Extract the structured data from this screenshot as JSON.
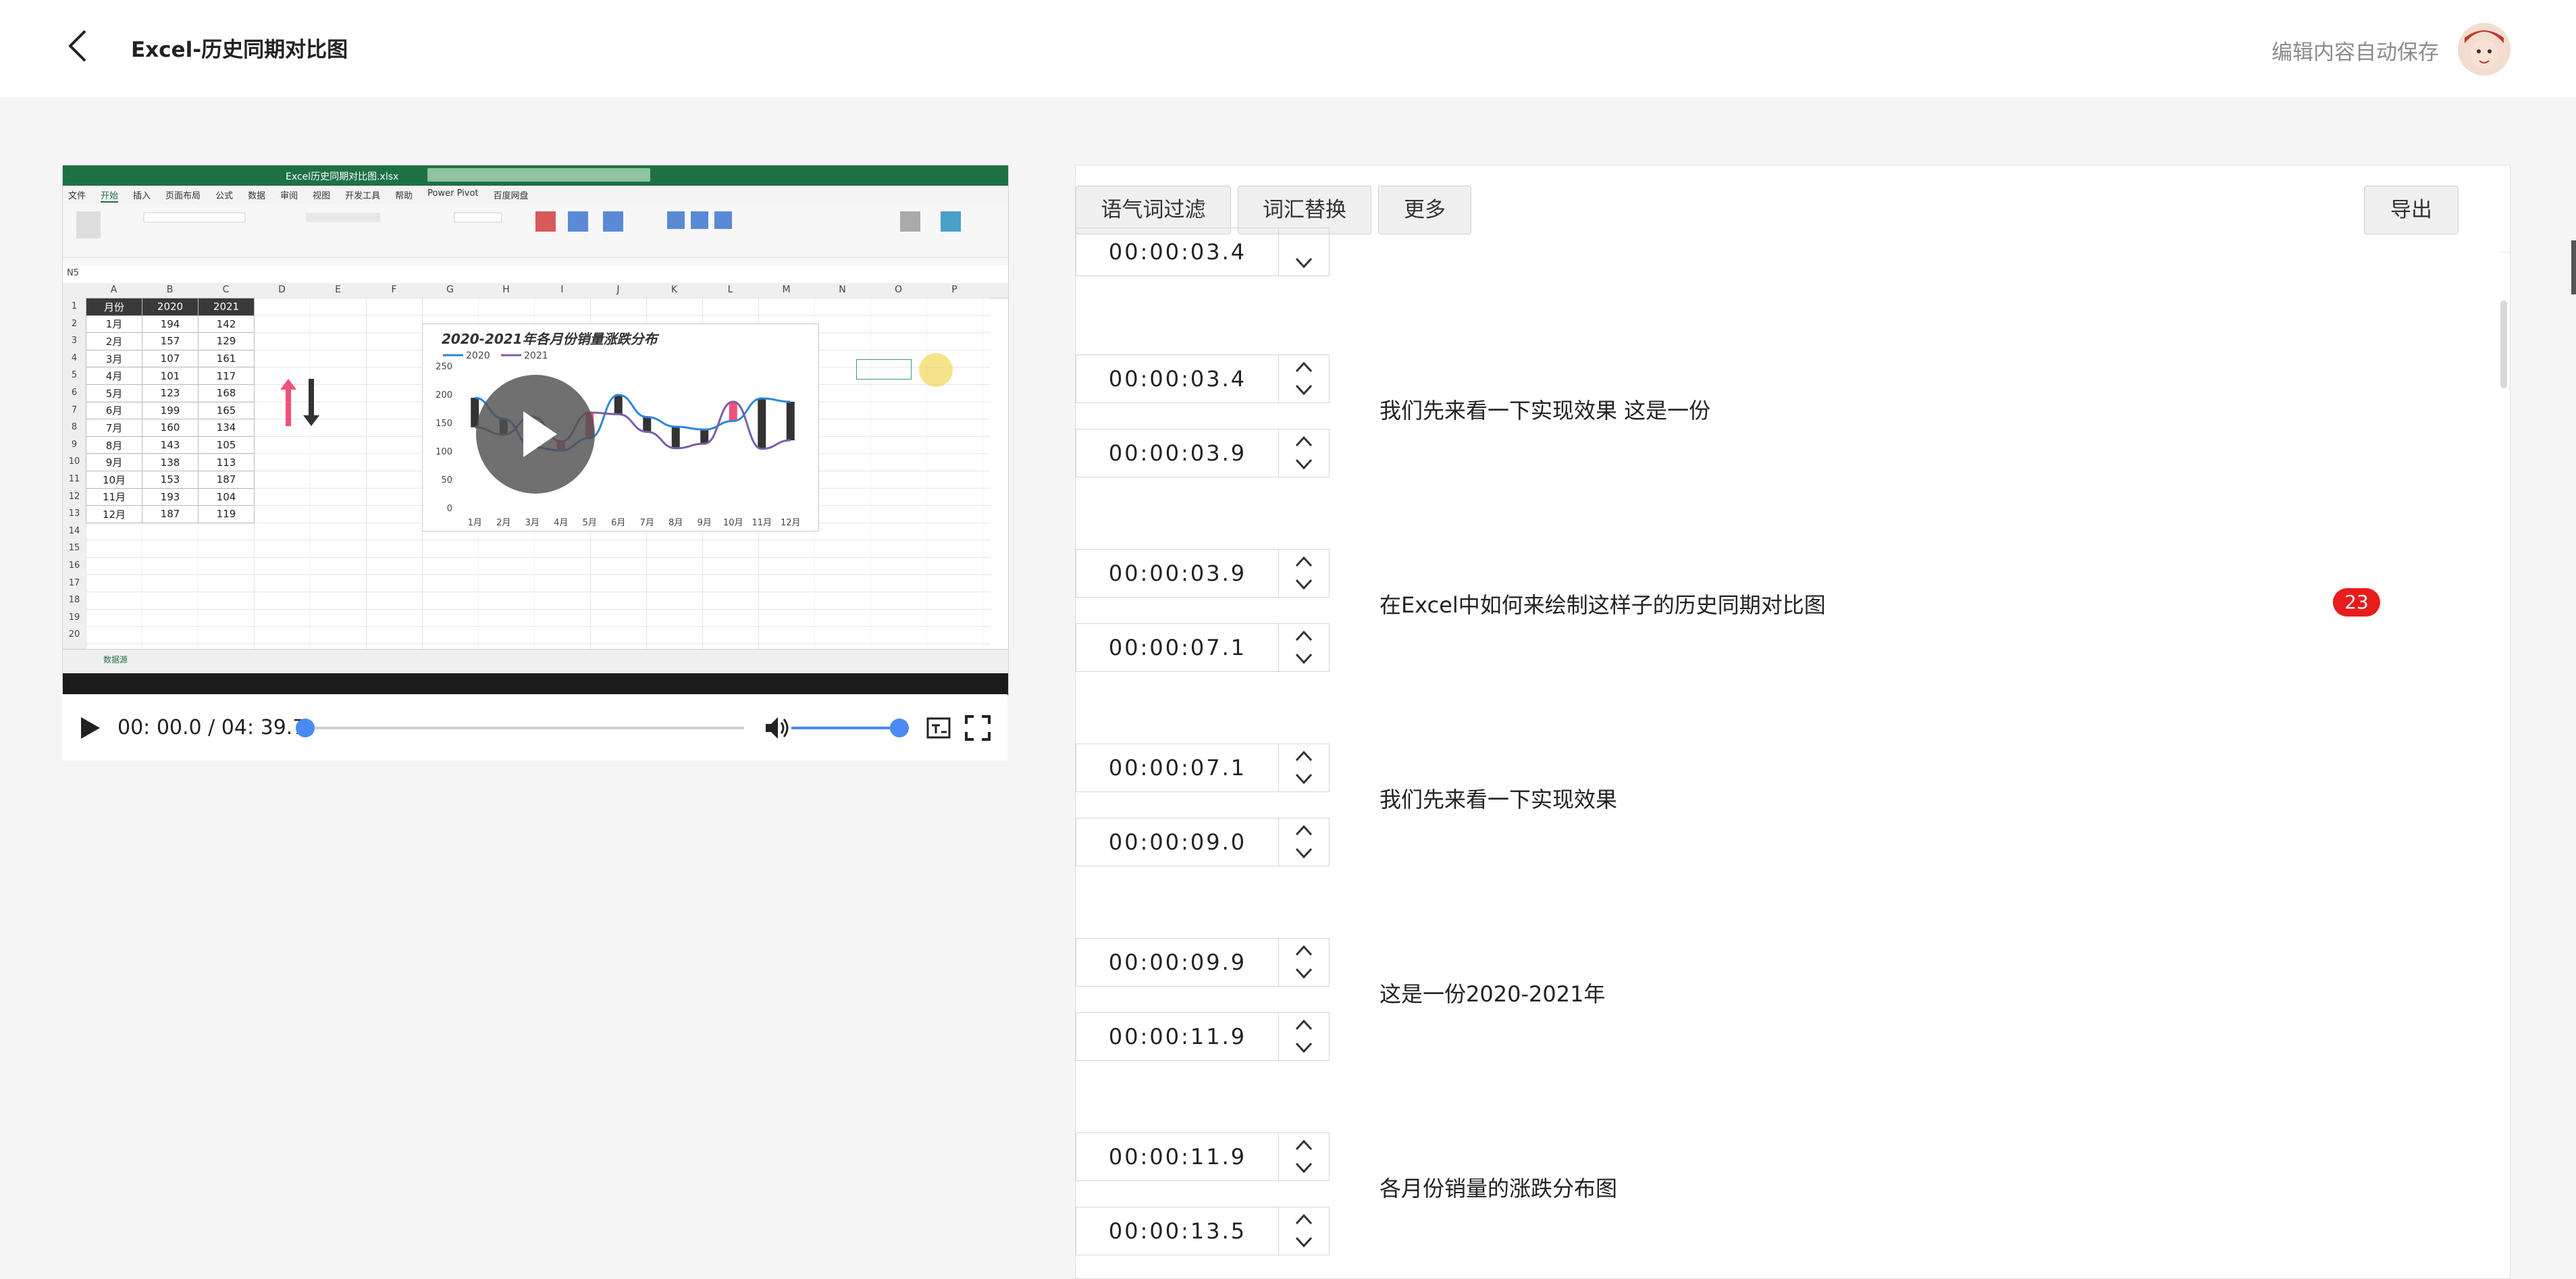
{
  "header": {
    "title": "Excel-历史同期对比图",
    "autosave_text": "编辑内容自动保存"
  },
  "video": {
    "excel": {
      "file_name": "Excel历史同期对比图.xlsx",
      "menu_tabs": [
        "文件",
        "开始",
        "插入",
        "页面布局",
        "公式",
        "数据",
        "审阅",
        "视图",
        "开发工具",
        "帮助",
        "Power Pivot",
        "百度网盘"
      ],
      "column_letters": [
        "A",
        "B",
        "C",
        "D",
        "E",
        "F",
        "G",
        "H",
        "I",
        "J",
        "K",
        "L",
        "M",
        "N",
        "O",
        "P"
      ],
      "row_numbers": [
        "1",
        "2",
        "3",
        "4",
        "5",
        "6",
        "7",
        "8",
        "9",
        "10",
        "11",
        "12",
        "13",
        "14",
        "15",
        "16",
        "17",
        "18",
        "19",
        "20"
      ],
      "table_headers": [
        "月份",
        "2020",
        "2021"
      ],
      "table_rows": [
        [
          "1月",
          "194",
          "142"
        ],
        [
          "2月",
          "157",
          "129"
        ],
        [
          "3月",
          "107",
          "161"
        ],
        [
          "4月",
          "101",
          "117"
        ],
        [
          "5月",
          "123",
          "168"
        ],
        [
          "6月",
          "199",
          "165"
        ],
        [
          "7月",
          "160",
          "134"
        ],
        [
          "8月",
          "143",
          "105"
        ],
        [
          "9月",
          "138",
          "113"
        ],
        [
          "10月",
          "153",
          "187"
        ],
        [
          "11月",
          "193",
          "104"
        ],
        [
          "12月",
          "187",
          "119"
        ]
      ],
      "sheet_tab": "数据源",
      "cell_ref": "N5"
    },
    "time_display": "00: 00.0 / 04: 39.7",
    "progress": 0,
    "volume": 1.0
  },
  "chart_data": {
    "type": "line",
    "title": "2020-2021年各月份销量涨跌分布",
    "categories": [
      "1月",
      "2月",
      "3月",
      "4月",
      "5月",
      "6月",
      "7月",
      "8月",
      "9月",
      "10月",
      "11月",
      "12月"
    ],
    "series": [
      {
        "name": "2020",
        "values": [
          194,
          157,
          107,
          101,
          123,
          199,
          160,
          143,
          138,
          153,
          193,
          187
        ]
      },
      {
        "name": "2021",
        "values": [
          142,
          129,
          161,
          117,
          168,
          165,
          134,
          105,
          113,
          187,
          104,
          119
        ]
      }
    ],
    "yticks": [
      "250",
      "200",
      "150",
      "100",
      "50",
      "0"
    ],
    "ylim": [
      0,
      250
    ],
    "legend": "top-left"
  },
  "panel": {
    "buttons": {
      "filter": "语气词过滤",
      "replace": "词汇替换",
      "more": "更多",
      "export": "导出"
    },
    "partial_time": "00:00:03.4",
    "segments": [
      {
        "start": "00:00:03.4",
        "end": "00:00:03.9",
        "text": "我们先来看一下实现效果 这是一份"
      },
      {
        "start": "00:00:03.9",
        "end": "00:00:07.1",
        "text": "在Excel中如何来绘制这样子的历史同期对比图",
        "badge": "23"
      },
      {
        "start": "00:00:07.1",
        "end": "00:00:09.0",
        "text": " 我们先来看一下实现效果"
      },
      {
        "start": "00:00:09.9",
        "end": "00:00:11.9",
        "text": "这是一份2020-2021年"
      },
      {
        "start": "00:00:11.9",
        "end": "00:00:13.5",
        "text": "各月份销量的涨跌分布图"
      }
    ]
  },
  "colors": {
    "excel_green": "#1e7145",
    "accent_blue": "#4a8af4",
    "badge_red": "#e81c1c",
    "series_2020": "#2f86d6",
    "series_2021": "#7b5ea8",
    "up_arrow": "#f0507a",
    "down_arrow": "#333333"
  }
}
